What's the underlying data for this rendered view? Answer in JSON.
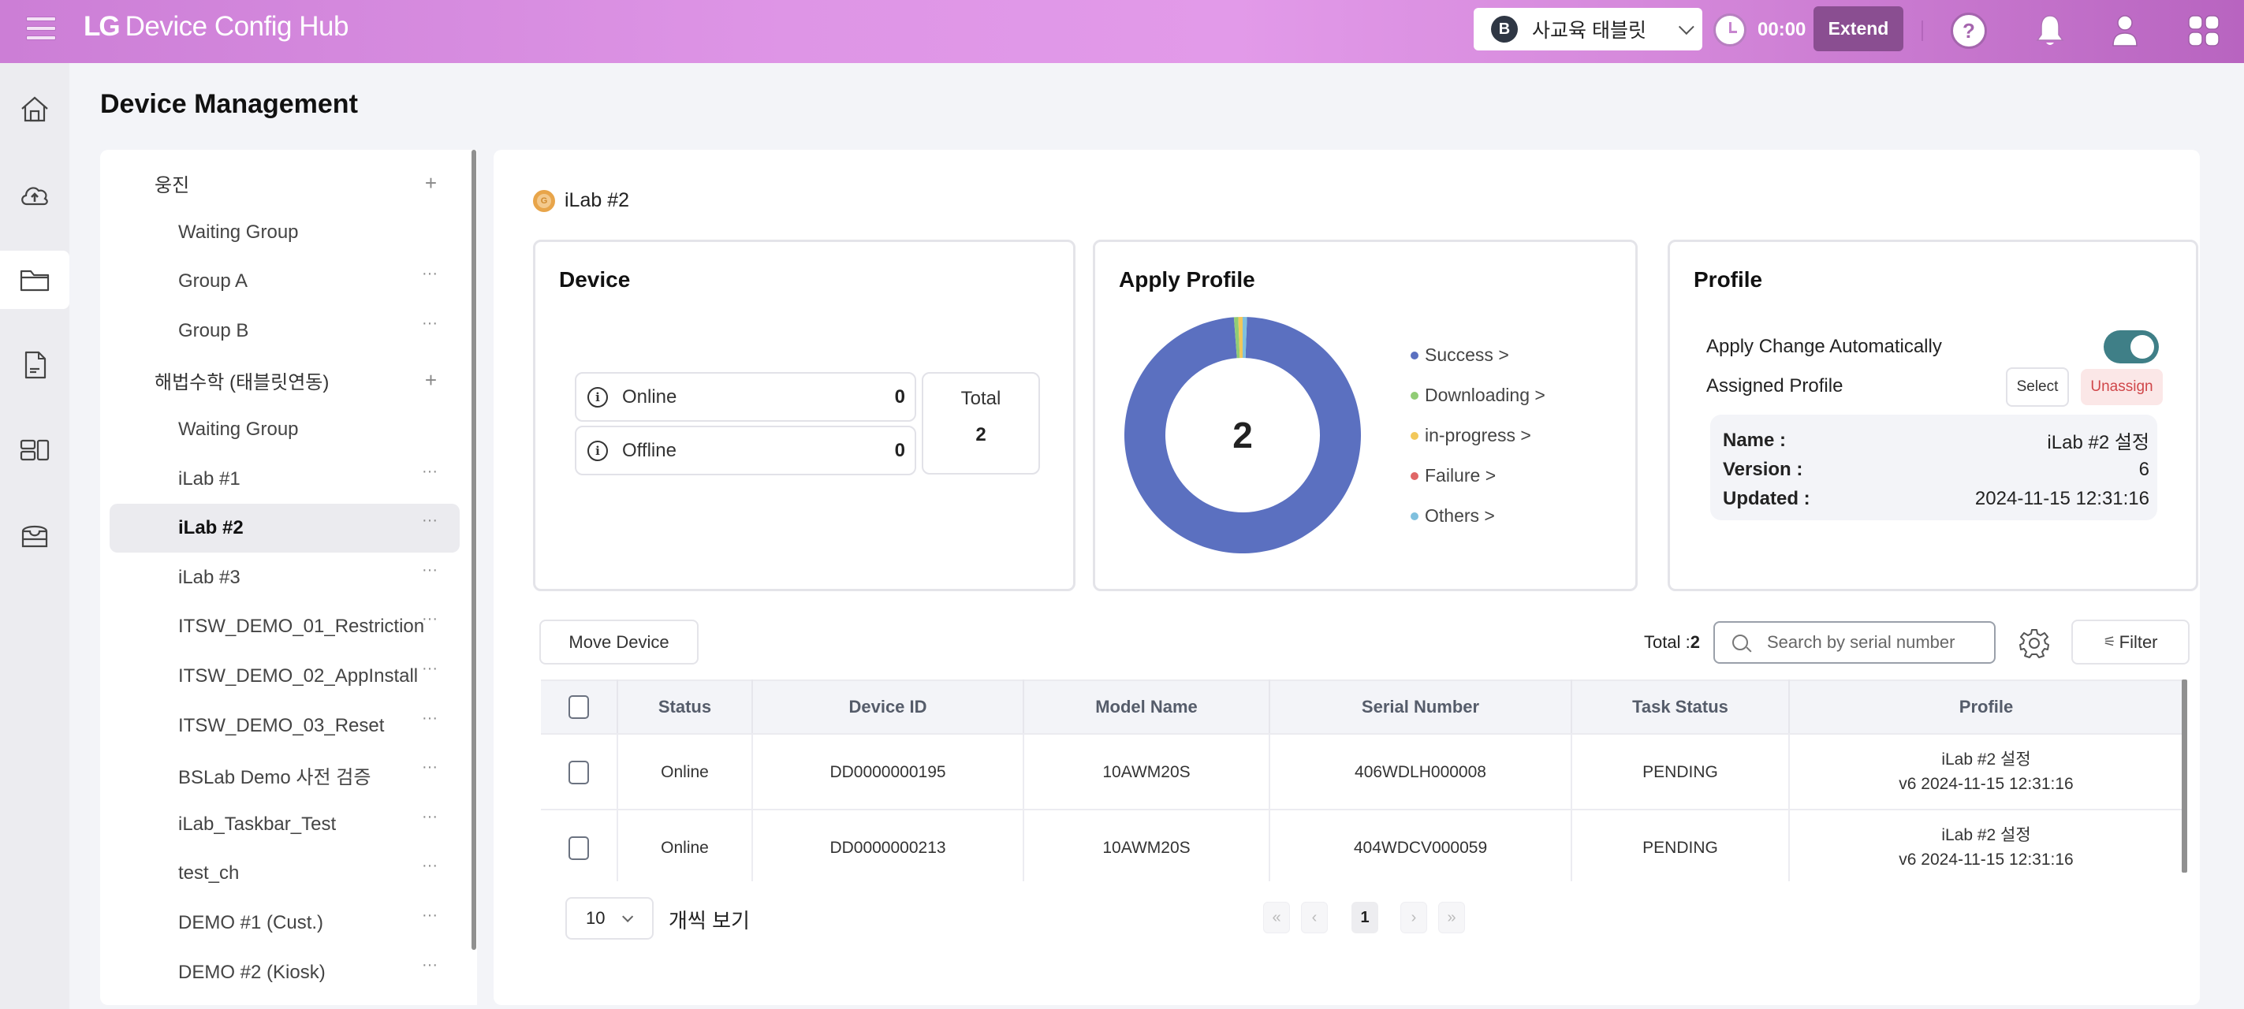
{
  "header": {
    "brand_logo": "LG",
    "brand_name": "Device Config Hub",
    "tenant": {
      "badge": "B",
      "name": "사교육 태블릿"
    },
    "timer": "00:00",
    "extend_label": "Extend",
    "help_glyph": "?",
    "icons": [
      "menu-icon",
      "clock-icon",
      "help-icon",
      "bell-icon",
      "user-icon",
      "apps-grid-icon"
    ]
  },
  "rail": {
    "items": [
      {
        "icon": "home-icon",
        "active": false
      },
      {
        "icon": "cloud-upload-icon",
        "active": false
      },
      {
        "icon": "folder-icon",
        "active": true
      },
      {
        "icon": "document-icon",
        "active": false
      },
      {
        "icon": "layout-icon",
        "active": false
      },
      {
        "icon": "inbox-icon",
        "active": false
      }
    ]
  },
  "page": {
    "title": "Device Management"
  },
  "tree": {
    "add_glyph": "+",
    "more_glyph": "···",
    "items": [
      {
        "label": "웅진",
        "type": "group",
        "action": "add"
      },
      {
        "label": "Waiting Group",
        "type": "sub",
        "action": "none"
      },
      {
        "label": "Group A",
        "type": "sub",
        "action": "more"
      },
      {
        "label": "Group B",
        "type": "sub",
        "action": "more"
      },
      {
        "label": "해법수학 (태블릿연동)",
        "type": "group",
        "action": "add"
      },
      {
        "label": "Waiting Group",
        "type": "sub",
        "action": "none"
      },
      {
        "label": "iLab #1",
        "type": "sub",
        "action": "more"
      },
      {
        "label": "iLab #2",
        "type": "sub",
        "action": "more",
        "active": true
      },
      {
        "label": "iLab #3",
        "type": "sub",
        "action": "more"
      },
      {
        "label": "ITSW_DEMO_01_Restriction",
        "type": "sub",
        "action": "more"
      },
      {
        "label": "ITSW_DEMO_02_AppInstall",
        "type": "sub",
        "action": "more"
      },
      {
        "label": "ITSW_DEMO_03_Reset",
        "type": "sub",
        "action": "more"
      },
      {
        "label": "BSLab Demo 사전 검증",
        "type": "sub",
        "action": "more"
      },
      {
        "label": "iLab_Taskbar_Test",
        "type": "sub",
        "action": "more"
      },
      {
        "label": "test_ch",
        "type": "sub",
        "action": "more"
      },
      {
        "label": "DEMO #1 (Cust.)",
        "type": "sub",
        "action": "more"
      },
      {
        "label": "DEMO #2 (Kiosk)",
        "type": "sub",
        "action": "more"
      }
    ]
  },
  "breadcrumb": {
    "badge": "G",
    "label": "iLab #2"
  },
  "device_card": {
    "title": "Device",
    "online_label": "Online",
    "online_value": "0",
    "offline_label": "Offline",
    "offline_value": "0",
    "total_label": "Total",
    "total_value": "2",
    "info_glyph": "i"
  },
  "apply_profile_card": {
    "title": "Apply Profile",
    "center_value": "2"
  },
  "chart_data": {
    "type": "pie",
    "title": "Apply Profile",
    "donut": true,
    "center_label": "2",
    "legend_position": "right",
    "categories": [
      "Success >",
      "Downloading >",
      "in-progress >",
      "Failure >",
      "Others >"
    ],
    "values": [
      2,
      0,
      0,
      0,
      0
    ],
    "colors": [
      "#5b70c0",
      "#91cc75",
      "#f2c85b",
      "#e06666",
      "#7fc0de"
    ]
  },
  "profile_card": {
    "title": "Profile",
    "auto_apply_label": "Apply Change Automatically",
    "auto_apply_on": true,
    "assigned_label": "Assigned Profile",
    "select_label": "Select",
    "unassign_label": "Unassign",
    "info": [
      {
        "key": "Name :",
        "value": "iLab #2 설정"
      },
      {
        "key": "Version :",
        "value": "6"
      },
      {
        "key": "Updated :",
        "value": "2024-11-15 12:31:16"
      }
    ]
  },
  "toolbar": {
    "move_label": "Move Device",
    "total_prefix": "Total :",
    "total_value": "2",
    "search_placeholder": "Search by serial number",
    "search_value": "",
    "filter_label": "Filter",
    "filter_glyph": "⚟"
  },
  "table": {
    "columns": [
      "",
      "Status",
      "Device ID",
      "Model Name",
      "Serial Number",
      "Task Status",
      "Profile"
    ],
    "rows": [
      {
        "checked": false,
        "status": "Online",
        "device_id": "DD0000000195",
        "model": "10AWM20S",
        "serial": "406WDLH000008",
        "task_status": "PENDING",
        "profile_name": "iLab #2 설정",
        "profile_meta": "v6 2024-11-15 12:31:16"
      },
      {
        "checked": false,
        "status": "Online",
        "device_id": "DD0000000213",
        "model": "10AWM20S",
        "serial": "404WDCV000059",
        "task_status": "PENDING",
        "profile_name": "iLab #2 설정",
        "profile_meta": "v6 2024-11-15 12:31:16"
      }
    ]
  },
  "pagination": {
    "page_size": "10",
    "page_size_label": "개씩 보기",
    "first": "«",
    "prev": "‹",
    "current": "1",
    "next": "›",
    "last": "»"
  }
}
